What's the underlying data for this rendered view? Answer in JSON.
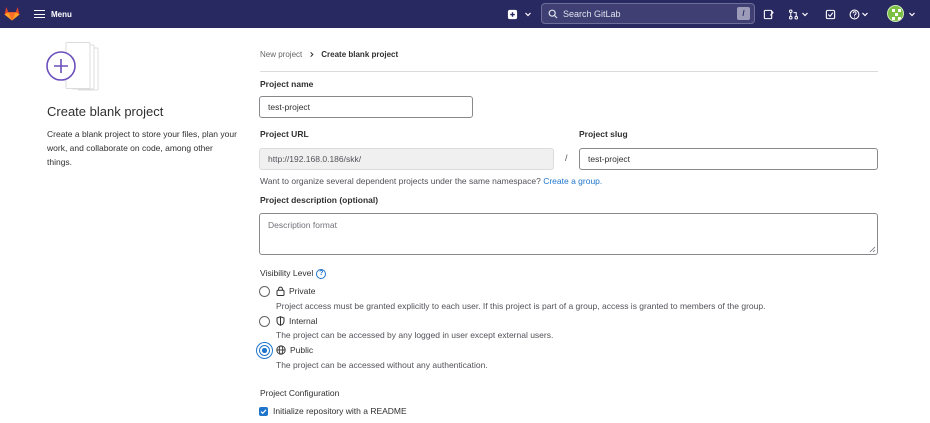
{
  "navbar": {
    "menu_label": "Menu",
    "search_placeholder": "Search GitLab",
    "search_shortcut": "/",
    "bg_color": "#292961"
  },
  "left_panel": {
    "title": "Create blank project",
    "description": "Create a blank project to store your files, plan your work, and collaborate on code, among other things."
  },
  "breadcrumb": {
    "parent": "New project",
    "current": "Create blank project"
  },
  "form": {
    "project_name_label": "Project name",
    "project_name_value": "test-project",
    "project_url_label": "Project URL",
    "project_url_value": "http://192.168.0.186/skk/",
    "url_separator": "/",
    "project_slug_label": "Project slug",
    "project_slug_value": "test-project",
    "namespace_helper": "Want to organize several dependent projects under the same namespace?",
    "create_group_link": "Create a group.",
    "description_label": "Project description (optional)",
    "description_placeholder": "Description format",
    "visibility_label": "Visibility Level",
    "visibility_options": [
      {
        "name": "Private",
        "icon": "lock-icon",
        "description": "Project access must be granted explicitly to each user. If this project is part of a group, access is granted to members of the group.",
        "selected": false
      },
      {
        "name": "Internal",
        "icon": "shield-icon",
        "description": "The project can be accessed by any logged in user except external users.",
        "selected": false
      },
      {
        "name": "Public",
        "icon": "globe-icon",
        "description": "The project can be accessed without any authentication.",
        "selected": true
      }
    ],
    "configuration_label": "Project Configuration",
    "readme_checkbox_label": "Initialize repository with a README",
    "readme_checked": true
  },
  "colors": {
    "accent": "#1f75cb",
    "text": "#303030",
    "muted": "#535158"
  }
}
